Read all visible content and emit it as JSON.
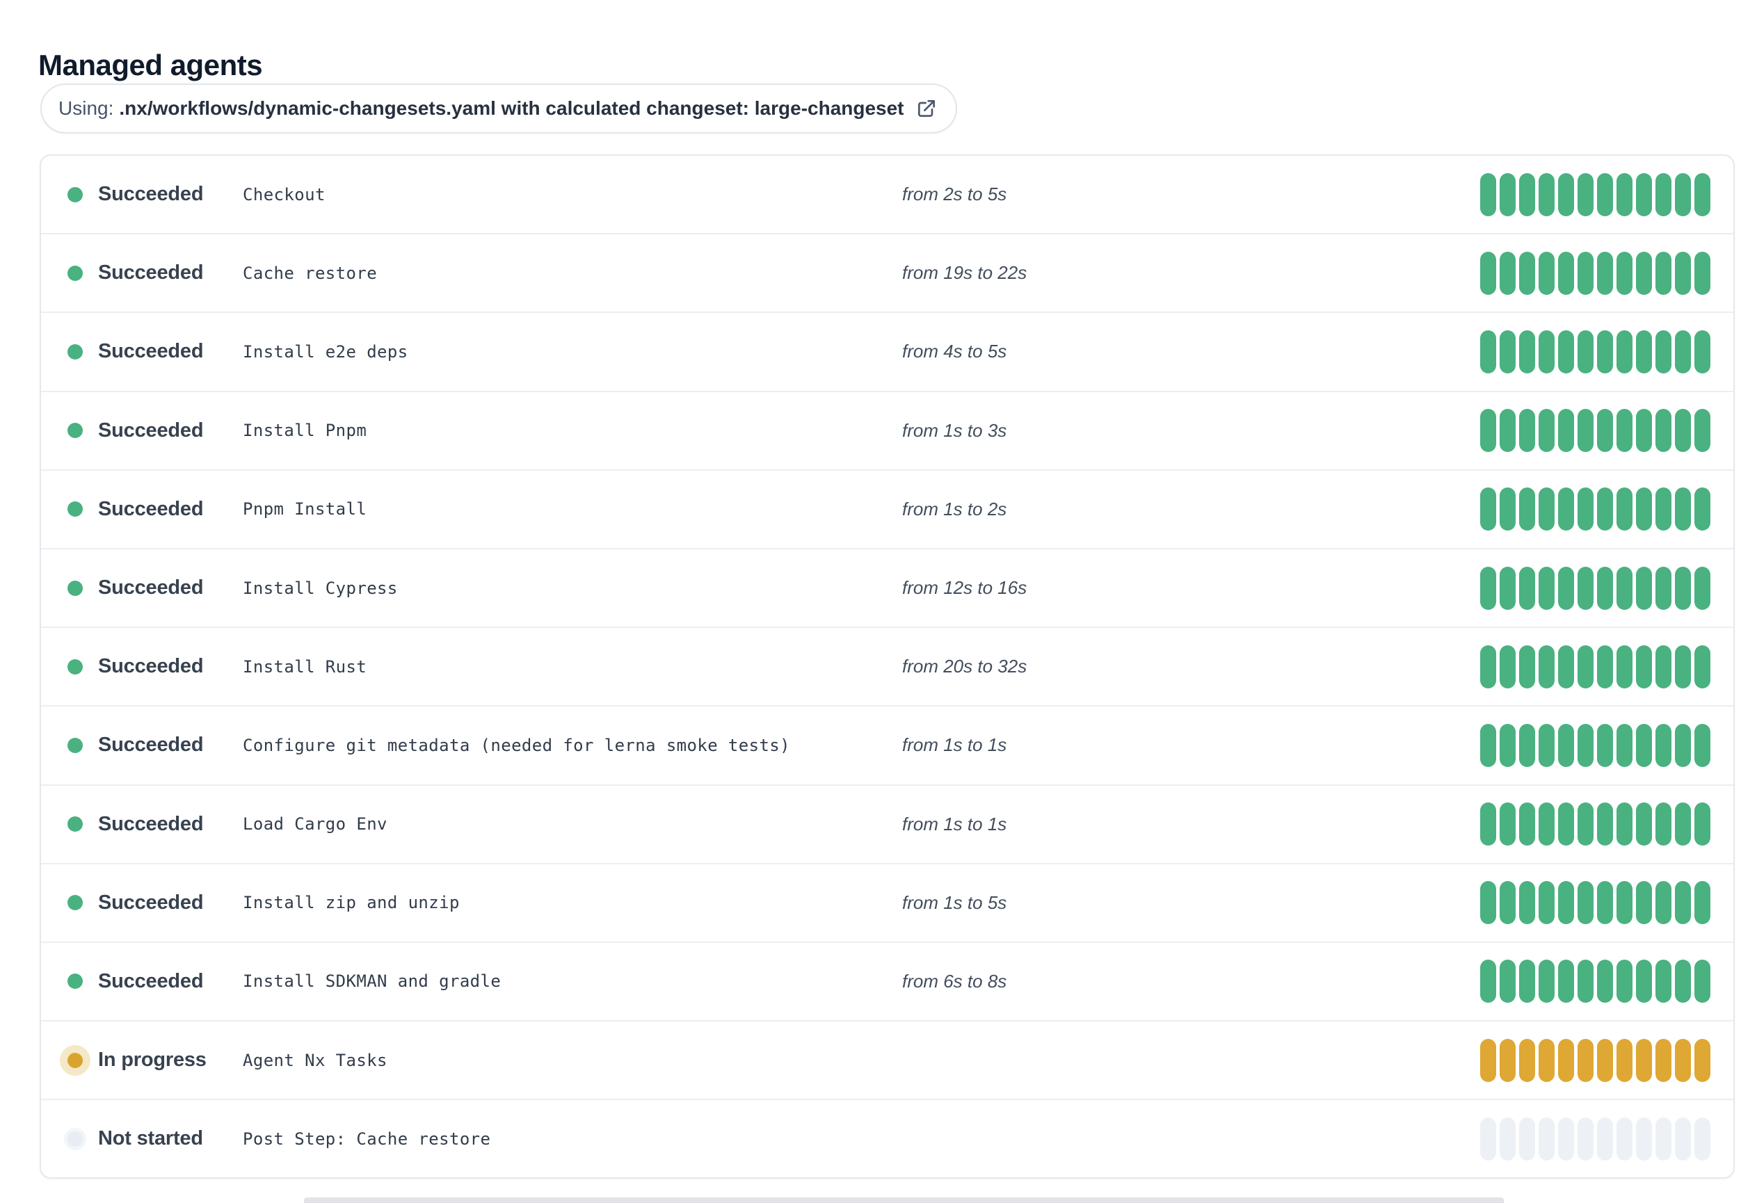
{
  "page": {
    "title": "Managed agents"
  },
  "workflow_banner": {
    "prefix": "Using:",
    "path_text": ".nx/workflows/dynamic-changesets.yaml with calculated changeset: large-changeset",
    "icon": "external-link-icon"
  },
  "agents": {
    "segments_per_bar": 12,
    "rows": [
      {
        "status": "Succeeded",
        "status_key": "succeeded",
        "step": "Checkout",
        "duration": "from 2s to 5s"
      },
      {
        "status": "Succeeded",
        "status_key": "succeeded",
        "step": "Cache restore",
        "duration": "from 19s to 22s"
      },
      {
        "status": "Succeeded",
        "status_key": "succeeded",
        "step": "Install e2e deps",
        "duration": "from 4s to 5s"
      },
      {
        "status": "Succeeded",
        "status_key": "succeeded",
        "step": "Install Pnpm",
        "duration": "from 1s to 3s"
      },
      {
        "status": "Succeeded",
        "status_key": "succeeded",
        "step": "Pnpm Install",
        "duration": "from 1s to 2s"
      },
      {
        "status": "Succeeded",
        "status_key": "succeeded",
        "step": "Install Cypress",
        "duration": "from 12s to 16s"
      },
      {
        "status": "Succeeded",
        "status_key": "succeeded",
        "step": "Install Rust",
        "duration": "from 20s to 32s"
      },
      {
        "status": "Succeeded",
        "status_key": "succeeded",
        "step": "Configure git metadata (needed for lerna smoke tests)",
        "duration": "from 1s to 1s"
      },
      {
        "status": "Succeeded",
        "status_key": "succeeded",
        "step": "Load Cargo Env",
        "duration": "from 1s to 1s"
      },
      {
        "status": "Succeeded",
        "status_key": "succeeded",
        "step": "Install zip and unzip",
        "duration": "from 1s to 5s"
      },
      {
        "status": "Succeeded",
        "status_key": "succeeded",
        "step": "Install SDKMAN and gradle",
        "duration": "from 6s to 8s"
      },
      {
        "status": "In progress",
        "status_key": "in-progress",
        "step": "Agent Nx Tasks",
        "duration": ""
      },
      {
        "status": "Not started",
        "status_key": "not-started",
        "step": "Post Step: Cache restore",
        "duration": ""
      }
    ]
  },
  "colors": {
    "succeeded": "#4ab180",
    "in_progress_segment": "#dfa733",
    "in_progress_dot": "#d9a42e",
    "in_progress_halo": "#f5e8c7",
    "not_started_segment": "#edf1f6",
    "not_started_dot": "#e9edf3"
  }
}
